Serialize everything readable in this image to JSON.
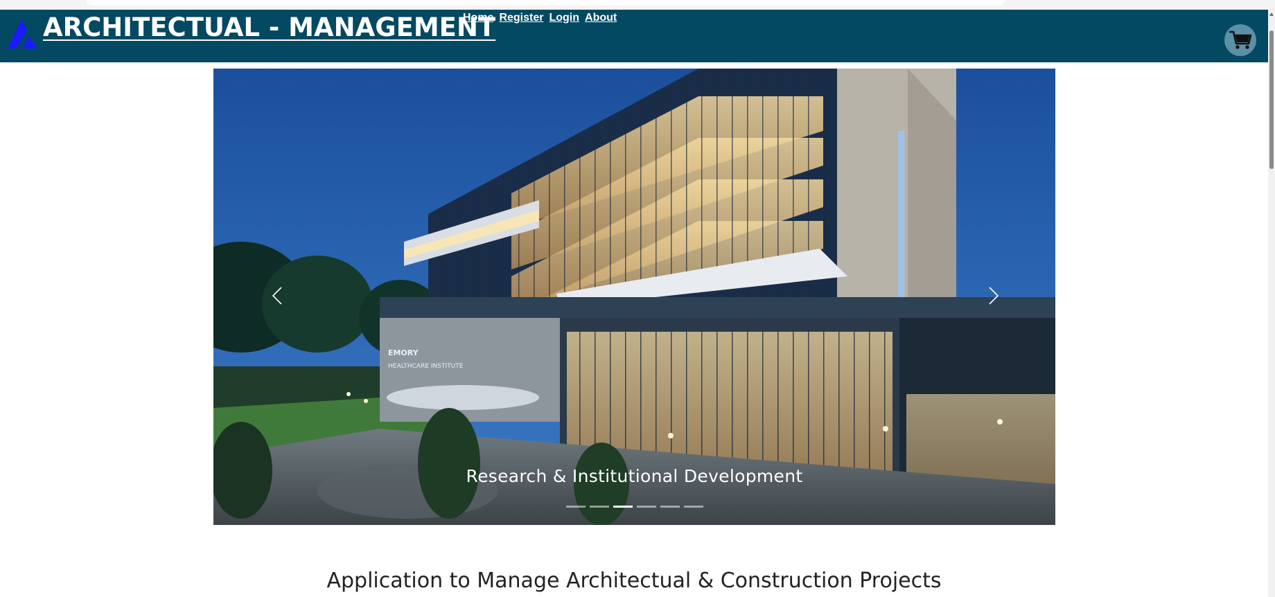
{
  "brand": {
    "logo_icon": "triangle-logo-icon",
    "title": "ARCHITECTUAL - MANAGEMENT"
  },
  "nav": {
    "items": [
      {
        "label": "Home"
      },
      {
        "label": "Register"
      },
      {
        "label": "Login"
      },
      {
        "label": "About"
      }
    ]
  },
  "cart": {
    "icon": "shopping-cart-icon"
  },
  "carousel": {
    "caption": "Research & Institutional Development",
    "slide_count": 6,
    "active_index": 2,
    "prev_icon": "chevron-left-icon",
    "next_icon": "chevron-right-icon"
  },
  "main": {
    "headline": "Application to Manage Architectual & Construction Projects"
  },
  "colors": {
    "navbar": "#034961",
    "logo": "#1a1aff",
    "cart_bg": "#5c90a7"
  }
}
